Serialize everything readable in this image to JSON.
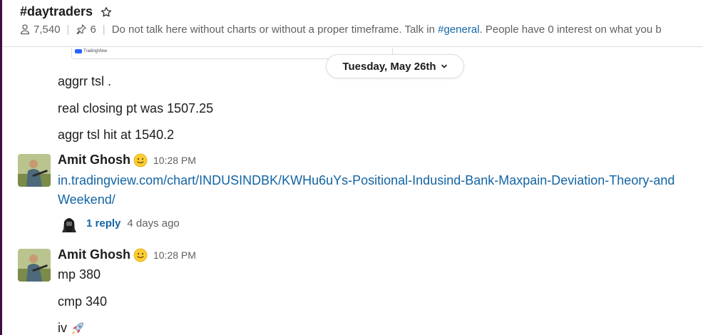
{
  "channel": {
    "name": "#daytraders",
    "member_count": "7,540",
    "pinned_count": "6",
    "topic_before": "Do not talk here without charts or without a proper timeframe. Talk in ",
    "topic_link": "#general",
    "topic_after": ". People have 0 interest on what you b"
  },
  "attachment": {
    "brand": "TradingView"
  },
  "date_divider": {
    "label": "Tuesday, May 26th"
  },
  "messages": {
    "cont_1": "aggrr tsl .",
    "cont_2": "real closing pt was 1507.25",
    "cont_3": "aggr tsl hit at 1540.2",
    "msg_a": {
      "author": "Amit Ghosh",
      "time": "10:28 PM",
      "link_line1": "in.tradingview.com/chart/INDUSINDBK/KWHu6uYs-Positional-Indusind-Bank-Maxpain-Deviation-Theory-and",
      "link_line2": "Weekend/",
      "reply_count": "1 reply",
      "reply_age": "4 days ago"
    },
    "msg_b": {
      "author": "Amit Ghosh",
      "time": "10:28 PM",
      "line1": "mp 380",
      "line2": "cmp 340",
      "line3": "iv"
    }
  },
  "icons": {
    "star": "star-icon",
    "members": "person-icon",
    "pins": "pin-icon",
    "chevron": "chevron-down-icon",
    "status": "slightly-smiling-face-emoji",
    "rocket": "rocket-emoji"
  },
  "colors": {
    "link": "#1264a3",
    "sidebar": "#3f0e40",
    "muted": "#616061"
  }
}
